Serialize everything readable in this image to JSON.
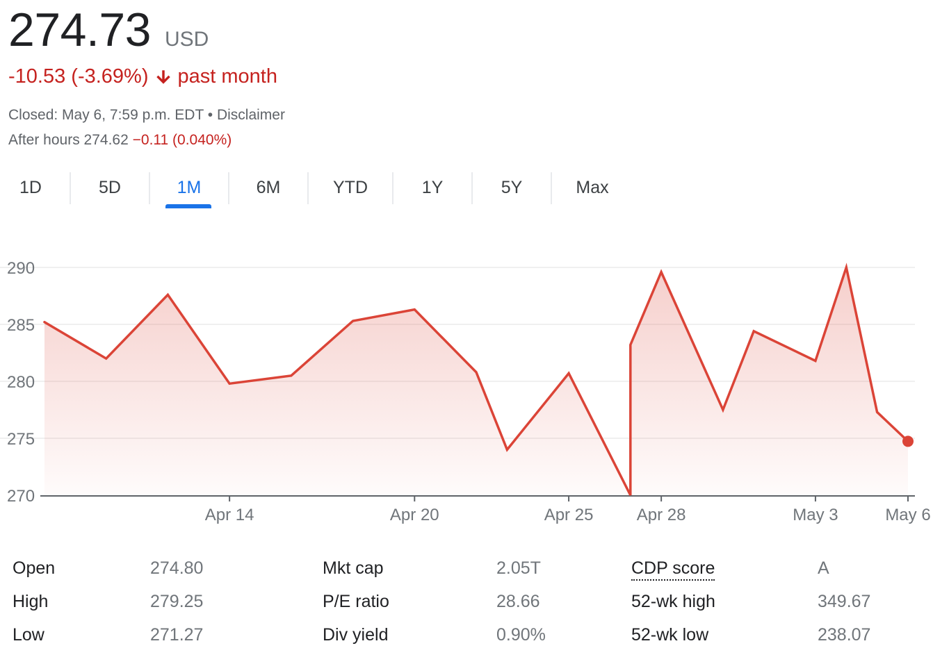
{
  "quote": {
    "price": "274.73",
    "currency": "USD",
    "change": "-10.53 (-3.69%)",
    "change_period": "past month",
    "status": "Closed: May 6, 7:59 p.m. EDT",
    "separator": "•",
    "disclaimer": "Disclaimer",
    "after_hours_label": "After hours 274.62",
    "after_hours_change": "−0.11 (0.040%)"
  },
  "colors": {
    "negative": "#c5221f",
    "line": "#db4437",
    "accent": "#1a73e8"
  },
  "icons": {
    "change_direction": "arrow-down-icon"
  },
  "tabs": [
    {
      "label": "1D",
      "active": false
    },
    {
      "label": "5D",
      "active": false
    },
    {
      "label": "1M",
      "active": true
    },
    {
      "label": "6M",
      "active": false
    },
    {
      "label": "YTD",
      "active": false
    },
    {
      "label": "1Y",
      "active": false
    },
    {
      "label": "5Y",
      "active": false
    },
    {
      "label": "Max",
      "active": false
    }
  ],
  "chart_data": {
    "type": "area",
    "series": [
      {
        "x": [
          "2024-04-08",
          "2024-04-10",
          "2024-04-12",
          "2024-04-14",
          "2024-04-16",
          "2024-04-18",
          "2024-04-20",
          "2024-04-22",
          "2024-04-23",
          "2024-04-25",
          "2024-04-27",
          "2024-04-27",
          "2024-04-28",
          "2024-04-30",
          "2024-05-01",
          "2024-05-03",
          "2024-05-04",
          "2024-05-05",
          "2024-05-06"
        ],
        "values": [
          285.2,
          282.0,
          287.6,
          279.8,
          280.5,
          285.3,
          286.3,
          280.8,
          274.0,
          280.7,
          270.0,
          283.2,
          289.6,
          277.5,
          284.4,
          281.8,
          290.0,
          277.3,
          274.73
        ]
      }
    ],
    "x_ticks": [
      "Apr 14",
      "Apr 20",
      "Apr 25",
      "Apr 28",
      "May 3",
      "May 6"
    ],
    "y_ticks": [
      270,
      275,
      280,
      285,
      290
    ],
    "ylim": [
      270,
      290
    ],
    "grid": true,
    "legend": "none",
    "title": "",
    "xlabel": "",
    "ylabel": ""
  },
  "stats": [
    {
      "label": "Open",
      "value": "274.80"
    },
    {
      "label": "High",
      "value": "279.25"
    },
    {
      "label": "Low",
      "value": "271.27"
    },
    {
      "label": "Mkt cap",
      "value": "2.05T"
    },
    {
      "label": "P/E ratio",
      "value": "28.66"
    },
    {
      "label": "Div yield",
      "value": "0.90%"
    },
    {
      "label": "CDP score",
      "value": "A"
    },
    {
      "label": "52-wk high",
      "value": "349.67"
    },
    {
      "label": "52-wk low",
      "value": "238.07"
    }
  ]
}
